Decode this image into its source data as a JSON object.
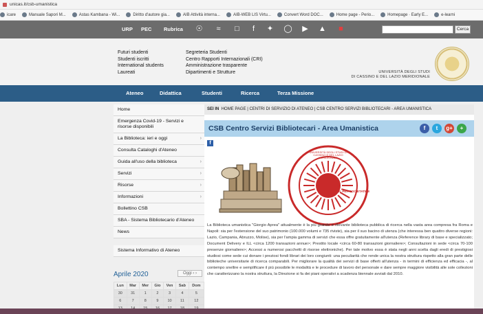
{
  "browser": {
    "url": "unicas.it/csb-umanistica",
    "bookmarks": [
      "icare",
      "Manuale Sapori M...",
      "Astas Kambana - Wi...",
      "Diritto d'autore gia...",
      "AIB Attività interna...",
      "AIB-WEB LIS Virtu...",
      "Convert Word DOC...",
      "Home page - Perio...",
      "Homepage · Early E...",
      "e-learni"
    ]
  },
  "topbar": {
    "links": [
      "URP",
      "PEC",
      "Rubrica"
    ],
    "icons": [
      "broadcast-icon",
      "wifi-icon",
      "monitor-icon",
      "facebook-icon",
      "twitter-icon",
      "instagram-icon",
      "youtube-icon",
      "graduation-cap-icon",
      "flag-icon"
    ],
    "search_placeholder": "",
    "search_button": "Cerca"
  },
  "header": {
    "quicklinks_col1": [
      "Futuri studenti",
      "Studenti iscritti",
      "International students",
      "Laureati"
    ],
    "quicklinks_col2": [
      "Segreteria Studenti",
      "Centro Rapporti Internazionali (CRI)",
      "Amministrazione trasparente",
      "Dipartimenti e Strutture"
    ],
    "university_line1": "UNIVERSITÀ DEGLI STUDI",
    "university_line2": "DI CASSINO E DEL LAZIO MERIDIONALE"
  },
  "mainnav": [
    "Ateneo",
    "Didattica",
    "Studenti",
    "Ricerca",
    "Terza Missione"
  ],
  "sidebar": {
    "items": [
      {
        "label": "Home",
        "chevron": false
      },
      {
        "label": "Emergenza Covid-19 - Servizi e risorse disponibili",
        "chevron": false
      },
      {
        "label": "La Biblioteca: ieri e oggi",
        "chevron": true
      },
      {
        "label": "Consulta Cataloghi d'Ateneo",
        "chevron": false
      },
      {
        "label": "Guida all'uso della biblioteca",
        "chevron": true
      },
      {
        "label": "Servizi",
        "chevron": true
      },
      {
        "label": "Risorse",
        "chevron": true
      },
      {
        "label": "Informazioni",
        "chevron": true
      },
      {
        "label": "Bollettino CSB",
        "chevron": false
      },
      {
        "label": "SBA - Sistema Bibliotecario d'Ateneo",
        "chevron": false
      },
      {
        "label": "News",
        "chevron": false
      }
    ],
    "extra_item": "Sistema Informativo di Ateneo"
  },
  "calendar": {
    "title": "Aprile 2020",
    "nav": "Oggi  ‹  ›",
    "weekdays": [
      "Lun",
      "Mar",
      "Mer",
      "Gio",
      "Ven",
      "Sab",
      "Dom"
    ],
    "rows": [
      [
        "30",
        "31",
        "1",
        "2",
        "3",
        "4",
        "5"
      ],
      [
        "6",
        "7",
        "8",
        "9",
        "10",
        "11",
        "12"
      ],
      [
        "13",
        "14",
        "15",
        "16",
        "17",
        "18",
        "19"
      ]
    ]
  },
  "main": {
    "breadcrumb_prefix": "SEI IN",
    "breadcrumb": "HOME PAGE  |  CENTRI DI SERVIZIO DI ATENEO  |  CSB CENTRO SERVIZI BIBLIOTECARI - AREA UMANISTICA",
    "title": "CSB Centro Servizi Bibliotecari - Area Umanistica",
    "social": [
      {
        "label": "f",
        "color": "#3b5ea8"
      },
      {
        "label": "t",
        "color": "#2aa6de"
      },
      {
        "label": "g+",
        "color": "#d34836"
      },
      {
        "label": "+",
        "color": "#3aa64a"
      }
    ],
    "seal_text": "UNIVERSITÀ DEGLI STUDI DI CASSINO E DEL LAZIO MERIDIONALE",
    "seal_motto": "SOL PER SOCIETATEM",
    "paragraph": "La Biblioteca umanistica \"Giorgio Aprea\" attualmente è la più grande e rilevante biblioteca pubblica di ricerca nella vasta area compresa fra Roma e Napoli: sia per l'estensione del suo patrimonio (100.000 volumi e 735 riviste), sia per il suo bacino di utenza (che interessa ben quattro diverse regioni: Lazio, Campania, Abruzzo, Molise), sia per l'ampia gamma di servizi che essa offre gratuitamente all'utenza (Reference library di base e specializzato; Document Delivery e ILL <circa 1200 transazioni annue>; Prestito locale <circa 60-80 transazioni giornaliere>; Consultazioni in sede <circa 70-100 presenze giornaliere>; Accessi a numerosi pacchetti di risorse elettroniche). Per tale motivo essa è stata negli anni scelta dagli eredi di prestigiosi studiosi come sede cui donare i preziosi fondi librari dei loro congiunti: una peculiarità che rende unica la nostra struttura rispetto alla gran parte delle biblioteche universitarie di ricerca comparabili. Per migliorare la qualità dei servizi di base offerti all'utenza - in termini di efficienza ed efficacia -, al contempo snellire e semplificare il più possibile le modalità e le procedure di lavoro del personale e dare sempre maggiore visibilità alle sole collezioni che caratterizzano la nostra struttura, la Direzione si fa dei piani operativi a scadenza biennale avviati dal 2010."
  }
}
